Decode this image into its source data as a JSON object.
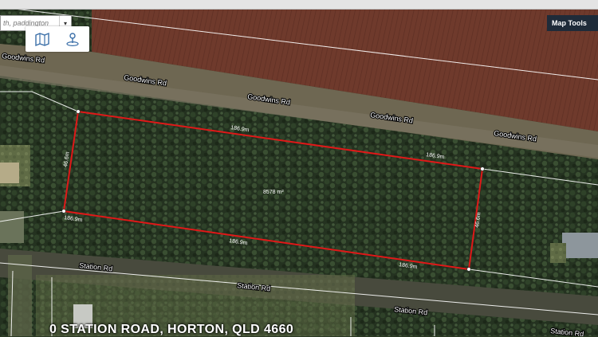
{
  "search": {
    "placeholder": "th, paddington",
    "dropdown_glyph": "▾"
  },
  "toolbar": {
    "tools": [
      "map-layers-icon",
      "location-pin-icon"
    ]
  },
  "map_tools": {
    "label": "Map Tools"
  },
  "roads": {
    "goodwins": [
      "Goodwins Rd",
      "Goodwins Rd",
      "Goodwins Rd",
      "Goodwins Rd",
      "Goodwins Rd"
    ],
    "station": [
      "Station Rd",
      "Station Rd",
      "Station Rd",
      "Station Rd"
    ]
  },
  "parcel": {
    "area": "8578 m²",
    "edges": [
      "186.9m",
      "186.9m",
      "186.9m",
      "186.9m",
      "46.6m",
      "46.6m"
    ],
    "colors": {
      "boundary": "#e01818",
      "cadastre": "#ffffff"
    }
  },
  "address": {
    "text": "0 STATION ROAD, HORTON, QLD 4660"
  }
}
